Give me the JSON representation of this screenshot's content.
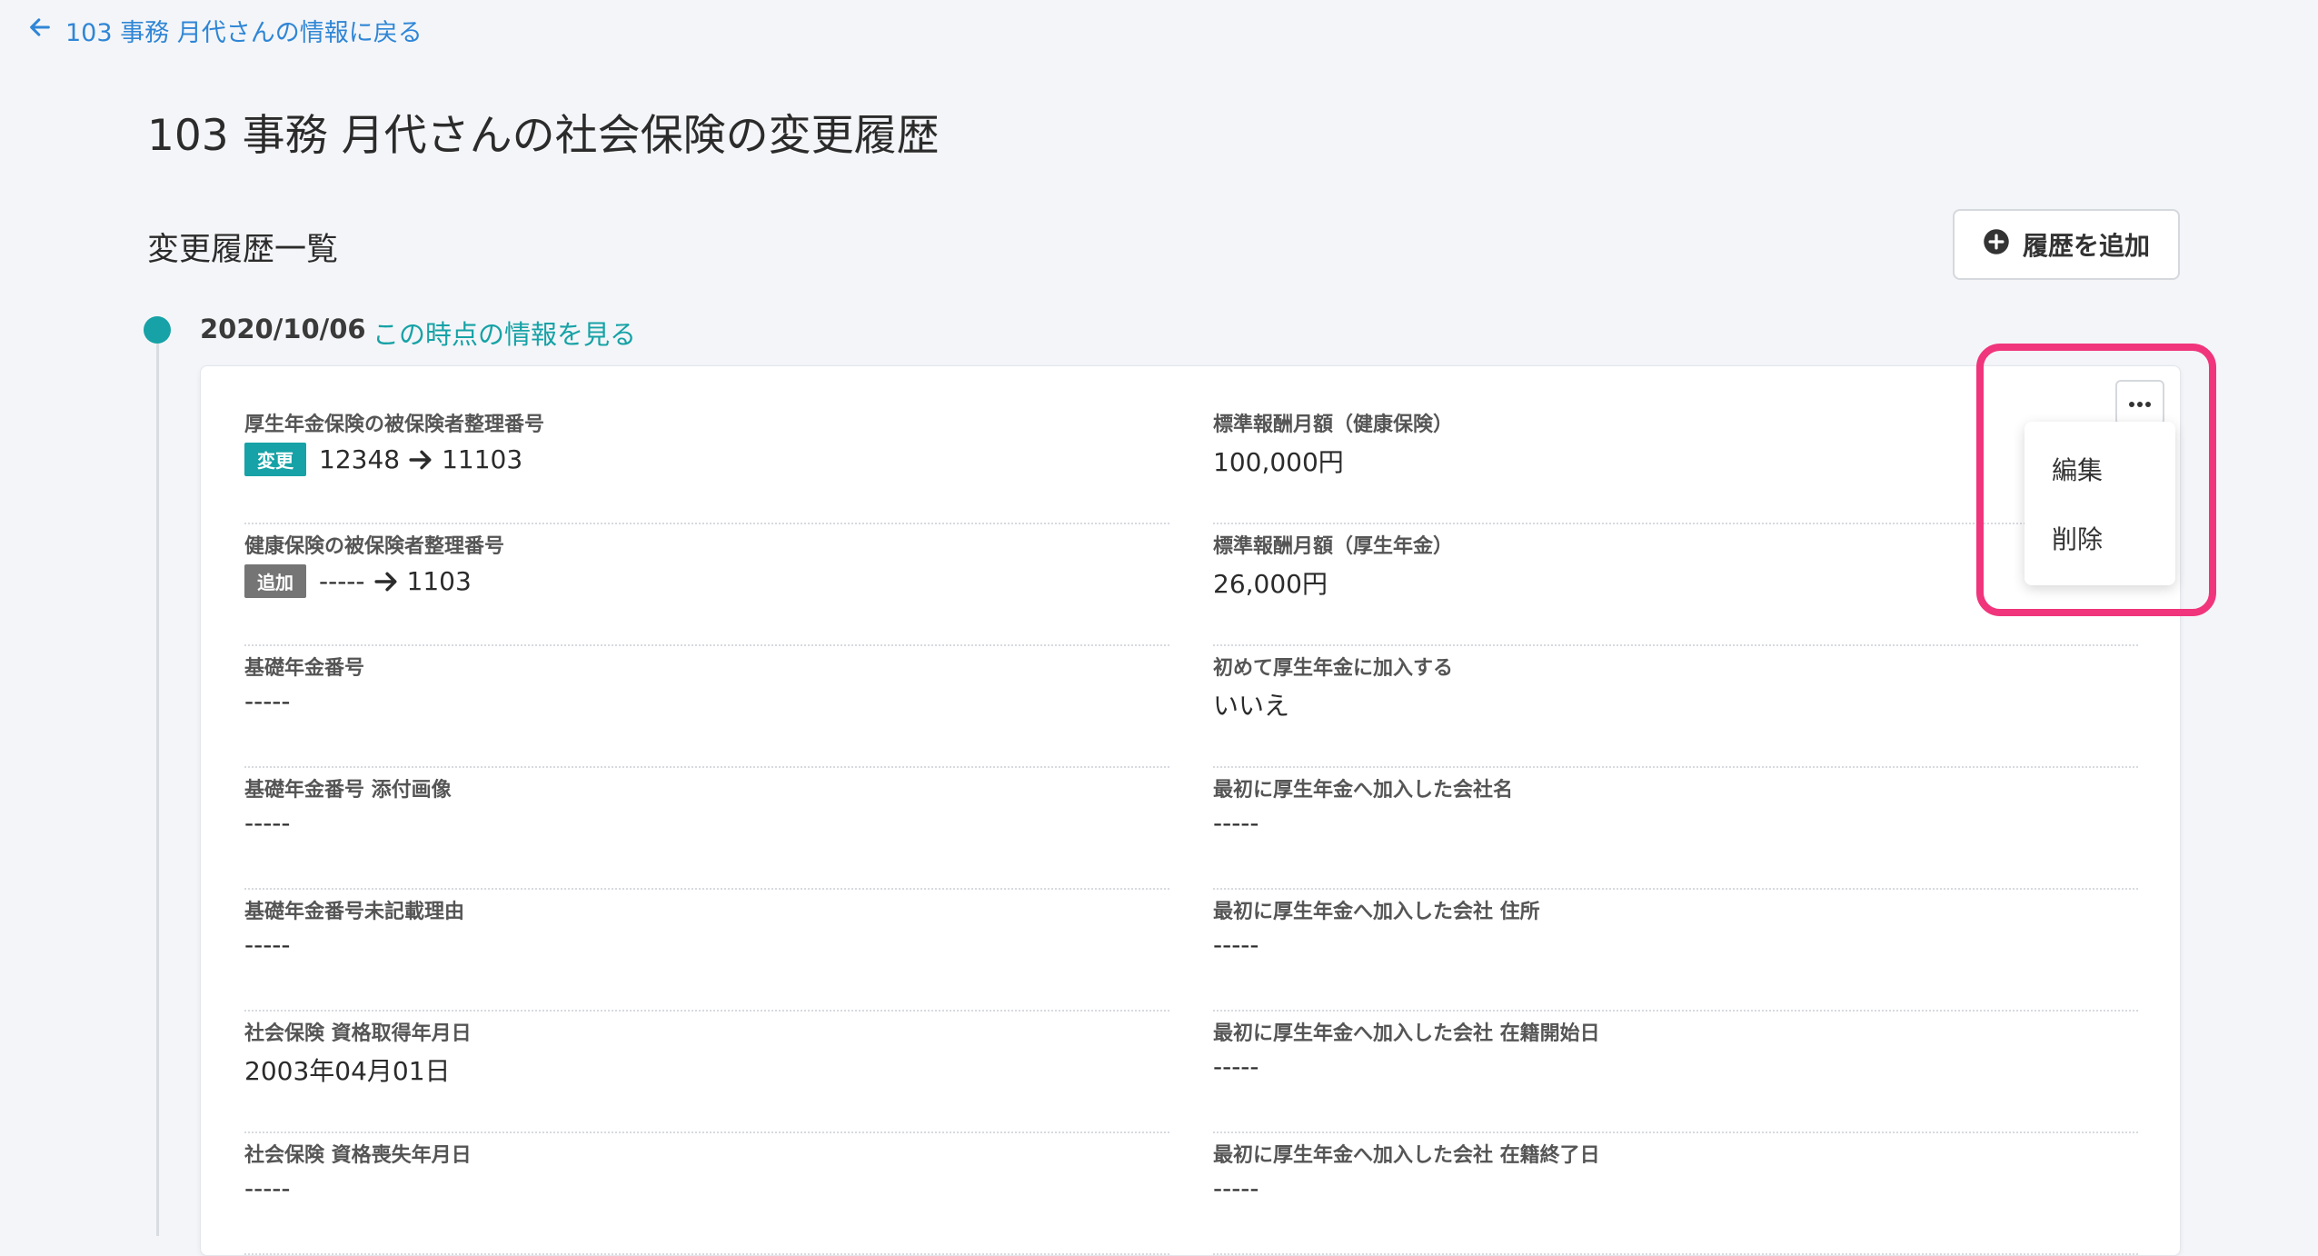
{
  "back_link": {
    "label": "103 事務 月代さんの情報に戻る"
  },
  "page_title": "103 事務 月代さんの社会保険の変更履歴",
  "section_title": "変更履歴一覧",
  "add_button": {
    "label": "履歴を追加"
  },
  "entry": {
    "date": "2020/10/06",
    "view_link": "この時点の情報を見る",
    "left_fields": [
      {
        "label": "厚生年金保険の被保険者整理番号",
        "tag": "変更",
        "from": "12348",
        "to": "11103"
      },
      {
        "label": "健康保険の被保険者整理番号",
        "tag": "追加",
        "from": "-----",
        "to": "1103"
      },
      {
        "label": "基礎年金番号",
        "value": "-----"
      },
      {
        "label": "基礎年金番号 添付画像",
        "value": "-----"
      },
      {
        "label": "基礎年金番号未記載理由",
        "value": "-----"
      },
      {
        "label": "社会保険 資格取得年月日",
        "value": "2003年04月01日"
      },
      {
        "label": "社会保険 資格喪失年月日",
        "value": "-----"
      }
    ],
    "right_fields": [
      {
        "label": "標準報酬月額（健康保険）",
        "value": "100,000円"
      },
      {
        "label": "標準報酬月額（厚生年金）",
        "value": "26,000円"
      },
      {
        "label": "初めて厚生年金に加入する",
        "value": "いいえ"
      },
      {
        "label": "最初に厚生年金へ加入した会社名",
        "value": "-----"
      },
      {
        "label": "最初に厚生年金へ加入した会社 住所",
        "value": "-----"
      },
      {
        "label": "最初に厚生年金へ加入した会社 在籍開始日",
        "value": "-----"
      },
      {
        "label": "最初に厚生年金へ加入した会社 在籍終了日",
        "value": "-----"
      }
    ]
  },
  "menu": {
    "edit": "編集",
    "delete": "削除"
  },
  "icons": {
    "back": "arrow-left-icon",
    "add": "plus-circle-icon",
    "more": "ellipsis-icon",
    "change_arrow": "arrow-right-icon"
  },
  "colors": {
    "accent": "#16a2a6",
    "link": "#2f86d6",
    "tag_change": "#16a2a6",
    "tag_add": "#757575",
    "highlight": "#f0357c"
  }
}
